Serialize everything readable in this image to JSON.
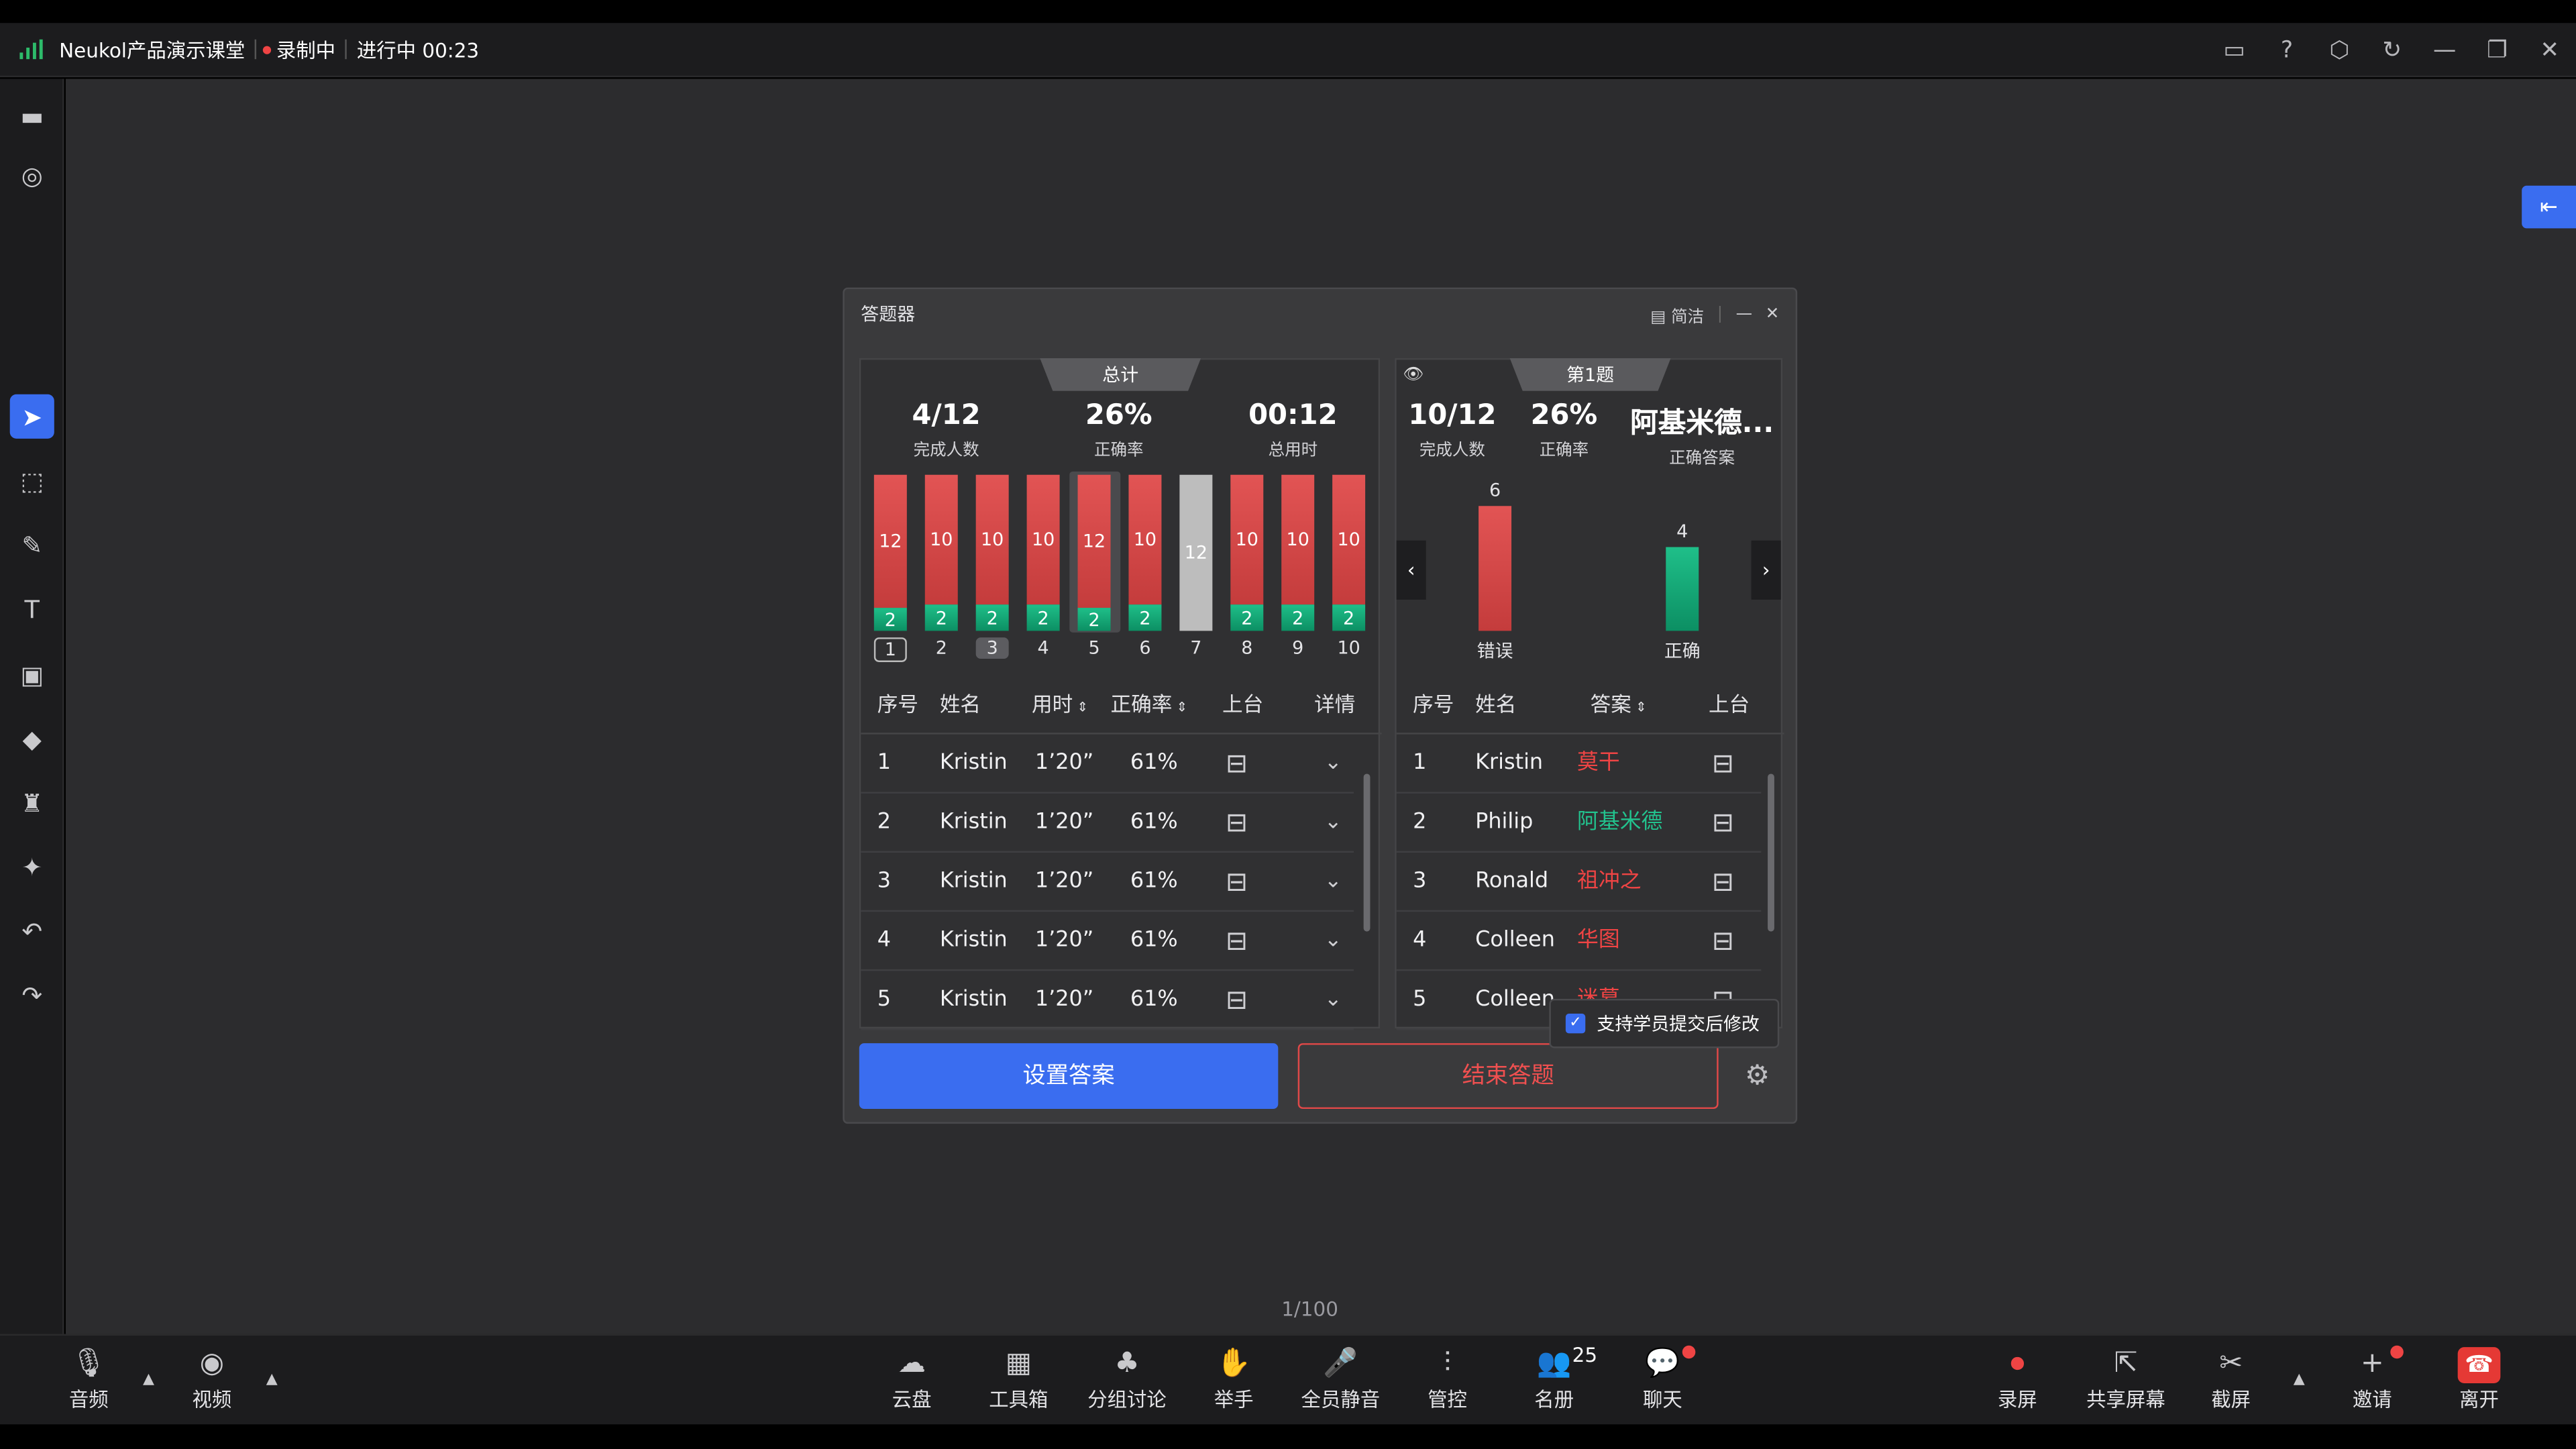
{
  "topbar": {
    "app_title": "Neukol产品演示课堂",
    "recording": "录制中",
    "status": "进行中 00:23"
  },
  "page_indicator": "1/100",
  "bottombar": {
    "audio": "音频",
    "video": "视频",
    "cloud": "云盘",
    "toolbox": "工具箱",
    "group": "分组讨论",
    "raise_hand": "举手",
    "mute_all": "全员静音",
    "control": "管控",
    "roster": "名册",
    "roster_count": "25",
    "chat": "聊天",
    "record": "录屏",
    "share": "共享屏幕",
    "screenshot": "截屏",
    "invite": "邀请",
    "leave": "离开"
  },
  "quiz": {
    "title": "答题器",
    "simple_mode": "简洁",
    "summary": {
      "tab": "总计",
      "completed": "4/12",
      "completed_label": "完成人数",
      "accuracy": "26%",
      "accuracy_label": "正确率",
      "time": "00:12",
      "time_label": "总用时",
      "chart_data": {
        "type": "bar",
        "categories": [
          "1",
          "2",
          "3",
          "4",
          "5",
          "6",
          "7",
          "8",
          "9",
          "10"
        ],
        "series": [
          {
            "values": [
              12,
              10,
              10,
              10,
              12,
              10,
              null,
              10,
              10,
              10
            ],
            "color": "#d64646"
          },
          {
            "values": [
              2,
              2,
              2,
              2,
              2,
              2,
              null,
              2,
              2,
              2
            ],
            "color": "#14a775"
          },
          {
            "values": [
              null,
              null,
              null,
              null,
              null,
              null,
              12,
              null,
              null,
              null
            ],
            "color": "#bdbdbd"
          }
        ]
      },
      "table": {
        "headers": [
          "序号",
          "姓名",
          "用时",
          "正确率",
          "上台",
          "详情"
        ],
        "rows": [
          [
            "1",
            "Kristin",
            "1’20”",
            "61%"
          ],
          [
            "2",
            "Kristin",
            "1’20”",
            "61%"
          ],
          [
            "3",
            "Kristin",
            "1’20”",
            "61%"
          ],
          [
            "4",
            "Kristin",
            "1’20”",
            "61%"
          ],
          [
            "5",
            "Kristin",
            "1’20”",
            "61%"
          ]
        ]
      }
    },
    "question": {
      "tab": "第1题",
      "completed": "10/12",
      "completed_label": "完成人数",
      "accuracy": "26%",
      "accuracy_label": "正确率",
      "answer": "阿基米德...",
      "answer_label": "正确答案",
      "chart_data": {
        "type": "bar",
        "categories": [
          "错误",
          "正确"
        ],
        "values": [
          6,
          4
        ],
        "colors": [
          "#d64646",
          "#14a775"
        ]
      },
      "table": {
        "headers": [
          "序号",
          "姓名",
          "答案",
          "上台"
        ],
        "rows": [
          {
            "no": "1",
            "name": "Kristin",
            "answer": "莫干",
            "color": "#ef4444"
          },
          {
            "no": "2",
            "name": "Philip",
            "answer": "阿基米德",
            "color": "#22c38e"
          },
          {
            "no": "3",
            "name": "Ronald",
            "answer": "祖冲之",
            "color": "#ef4444"
          },
          {
            "no": "4",
            "name": "Colleen",
            "answer": "华图",
            "color": "#ef4444"
          },
          {
            "no": "5",
            "name": "Colleen",
            "answer": "迷幕",
            "color": "#ef4444"
          }
        ]
      }
    },
    "set_answer": "设置答案",
    "end_quiz": "结束答题",
    "allow_modify": "支持学员提交后修改"
  }
}
